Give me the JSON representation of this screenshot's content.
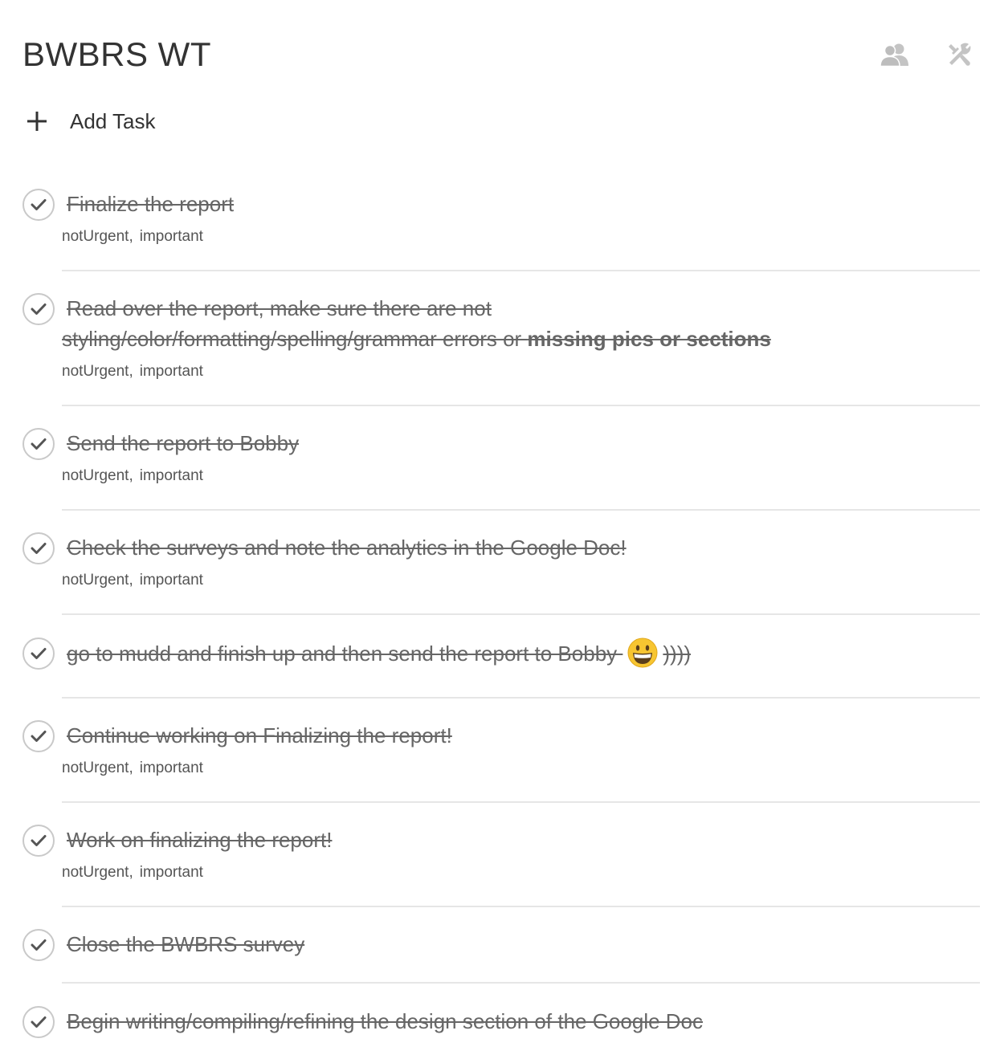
{
  "header": {
    "title": "BWBRS WT",
    "share_icon": "people-icon",
    "settings_icon": "tools-icon"
  },
  "add_task": {
    "icon": "plus-icon",
    "label": "Add Task"
  },
  "tasks": [
    {
      "text": "Finalize the report",
      "tag1": "notUrgent",
      "tag_sep": ",",
      "tag2": "important",
      "completed": true
    },
    {
      "text_line1": "Read over the report, make sure there are not",
      "text_line2": "styling/color/formatting/spelling/grammar errors or ",
      "text_bold": "missing pics or sections",
      "tag1": "notUrgent",
      "tag_sep": ",",
      "tag2": "important",
      "completed": true
    },
    {
      "text": "Send the report to Bobby",
      "tag1": "notUrgent",
      "tag_sep": ",",
      "tag2": "important",
      "completed": true
    },
    {
      "text": "Check the surveys and note the analytics in the Google Doc!",
      "tag1": "notUrgent",
      "tag_sep": ",",
      "tag2": "important",
      "completed": true
    },
    {
      "text": "go to mudd and finish up and then send the report to Bobby ",
      "emoji": "grinning-face-emoji",
      "text_after": "))))",
      "completed": true
    },
    {
      "text": "Continue working on Finalizing the report!",
      "tag1": "notUrgent",
      "tag_sep": ",",
      "tag2": "important",
      "completed": true
    },
    {
      "text": "Work on finalizing the report!",
      "tag1": "notUrgent",
      "tag_sep": ",",
      "tag2": "important",
      "completed": true
    },
    {
      "text": "Close the BWBRS survey",
      "completed": true
    },
    {
      "text": "Begin writing/compiling/refining the design section of the Google Doc",
      "completed": true
    }
  ],
  "colors": {
    "text": "#333333",
    "completed_text": "#666666",
    "checkmark": "#555555",
    "check_border": "#c9c9c9",
    "divider": "#e6e6e6",
    "header_icon": "#bfbfbf",
    "emoji_face": "#f7c531"
  }
}
